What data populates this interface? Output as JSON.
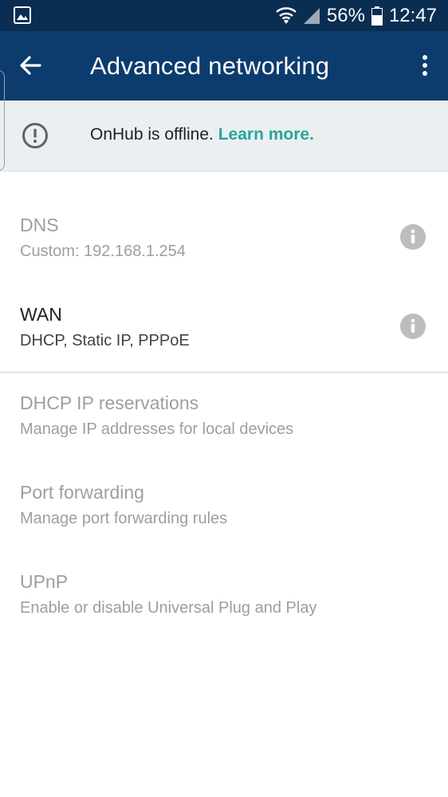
{
  "status_bar": {
    "battery": "56%",
    "time": "12:47"
  },
  "app_bar": {
    "title": "Advanced networking"
  },
  "banner": {
    "message": "OnHub is offline.",
    "link": "Learn more."
  },
  "items": [
    {
      "title": "DNS",
      "subtitle": "Custom: 192.168.1.254"
    },
    {
      "title": "WAN",
      "subtitle": "DHCP, Static IP, PPPoE"
    },
    {
      "title": "DHCP IP reservations",
      "subtitle": "Manage IP addresses for local devices"
    },
    {
      "title": "Port forwarding",
      "subtitle": "Manage port forwarding rules"
    },
    {
      "title": "UPnP",
      "subtitle": "Enable or disable Universal Plug and Play"
    }
  ],
  "colors": {
    "status_bar": "#0a2d52",
    "app_bar": "#0c3c6e",
    "accent": "#26a69a",
    "disabled_text": "#9e9e9e"
  }
}
